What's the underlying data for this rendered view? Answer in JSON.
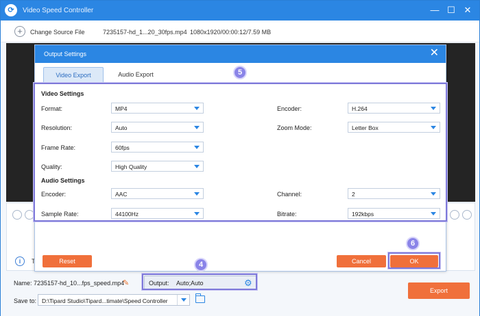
{
  "window": {
    "title": "Video Speed Controller",
    "logo_glyph": "⟳",
    "minimize_glyph": "—",
    "maximize_glyph": "☐",
    "close_glyph": "✕"
  },
  "toolbar": {
    "add_icon": "plus-circle-icon",
    "change_source_label": "Change Source File",
    "file_name": "7235157-hd_1...20_30fps.mp4",
    "file_info": "1080x1920/00:00:12/7.59 MB"
  },
  "info_text": "T",
  "dialog": {
    "title": "Output Settings",
    "close_glyph": "✕",
    "tabs": [
      {
        "label": "Video Export",
        "active": true
      },
      {
        "label": "Audio Export",
        "active": false
      }
    ],
    "video_settings_title": "Video Settings",
    "audio_settings_title": "Audio Settings",
    "format": {
      "label": "Format:",
      "value": "MP4"
    },
    "encoder": {
      "label": "Encoder:",
      "value": "H.264"
    },
    "resolution": {
      "label": "Resolution:",
      "value": "Auto"
    },
    "zoom_mode": {
      "label": "Zoom Mode:",
      "value": "Letter Box"
    },
    "frame_rate": {
      "label": "Frame Rate:",
      "value": "60fps"
    },
    "quality": {
      "label": "Quality:",
      "value": "High Quality"
    },
    "audio_encoder": {
      "label": "Encoder:",
      "value": "AAC"
    },
    "channel": {
      "label": "Channel:",
      "value": "2"
    },
    "sample_rate": {
      "label": "Sample Rate:",
      "value": "44100Hz"
    },
    "bitrate": {
      "label": "Bitrate:",
      "value": "192kbps"
    },
    "reset_label": "Reset",
    "cancel_label": "Cancel",
    "ok_label": "OK"
  },
  "steps": {
    "output": "4",
    "settings": "5",
    "ok": "6"
  },
  "bottom": {
    "name_label": "Name:",
    "name_value": "7235157-hd_10...fps_speed.mp4",
    "output_label": "Output:",
    "output_value": "Auto;Auto",
    "save_to_label": "Save to:",
    "save_to_value": "D:\\Tipard Studio\\Tipard...timate\\Speed Controller",
    "export_label": "Export"
  },
  "colors": {
    "accent": "#2b86e3",
    "button": "#f0703b",
    "highlight": "#7e79d9"
  }
}
